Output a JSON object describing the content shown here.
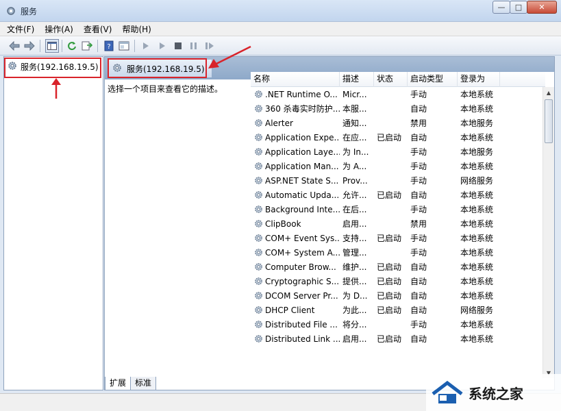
{
  "window": {
    "title": "服务",
    "minimize": "—",
    "maximize": "□",
    "close": "✕"
  },
  "menu": [
    "文件(F)",
    "操作(A)",
    "查看(V)",
    "帮助(H)"
  ],
  "tree": {
    "node_label": "服务(192.168.19.5)"
  },
  "right": {
    "header_label": "服务(192.168.19.5)",
    "description_hint": "选择一个项目来查看它的描述。",
    "columns": [
      "名称",
      "描述",
      "状态",
      "启动类型",
      "登录为"
    ],
    "rows": [
      {
        "name": ".NET Runtime O...",
        "desc": "Micr...",
        "state": "",
        "type": "手动",
        "logon": "本地系统"
      },
      {
        "name": "360 杀毒实时防护...",
        "desc": "本服...",
        "state": "",
        "type": "自动",
        "logon": "本地系统"
      },
      {
        "name": "Alerter",
        "desc": "通知...",
        "state": "",
        "type": "禁用",
        "logon": "本地服务"
      },
      {
        "name": "Application Expe...",
        "desc": "在应...",
        "state": "已启动",
        "type": "自动",
        "logon": "本地系统"
      },
      {
        "name": "Application Laye...",
        "desc": "为 In...",
        "state": "",
        "type": "手动",
        "logon": "本地服务"
      },
      {
        "name": "Application Man...",
        "desc": "为 A...",
        "state": "",
        "type": "手动",
        "logon": "本地系统"
      },
      {
        "name": "ASP.NET State S...",
        "desc": "Prov...",
        "state": "",
        "type": "手动",
        "logon": "网络服务"
      },
      {
        "name": "Automatic Upda...",
        "desc": "允许...",
        "state": "已启动",
        "type": "自动",
        "logon": "本地系统"
      },
      {
        "name": "Background Inte...",
        "desc": "在后...",
        "state": "",
        "type": "手动",
        "logon": "本地系统"
      },
      {
        "name": "ClipBook",
        "desc": "启用...",
        "state": "",
        "type": "禁用",
        "logon": "本地系统"
      },
      {
        "name": "COM+ Event Sys...",
        "desc": "支持...",
        "state": "已启动",
        "type": "手动",
        "logon": "本地系统"
      },
      {
        "name": "COM+ System A...",
        "desc": "管理...",
        "state": "",
        "type": "手动",
        "logon": "本地系统"
      },
      {
        "name": "Computer Brow...",
        "desc": "维护...",
        "state": "已启动",
        "type": "自动",
        "logon": "本地系统"
      },
      {
        "name": "Cryptographic S...",
        "desc": "提供...",
        "state": "已启动",
        "type": "自动",
        "logon": "本地系统"
      },
      {
        "name": "DCOM Server Pr...",
        "desc": "为 D...",
        "state": "已启动",
        "type": "自动",
        "logon": "本地系统"
      },
      {
        "name": "DHCP Client",
        "desc": "为此...",
        "state": "已启动",
        "type": "自动",
        "logon": "网络服务"
      },
      {
        "name": "Distributed File ...",
        "desc": "将分...",
        "state": "",
        "type": "手动",
        "logon": "本地系统"
      },
      {
        "name": "Distributed Link ...",
        "desc": "启用...",
        "state": "已启动",
        "type": "自动",
        "logon": "本地系统"
      }
    ],
    "tabs": [
      "扩展",
      "标准"
    ]
  },
  "watermark": {
    "text": "系统之家"
  },
  "colors": {
    "annotation_red": "#d9232a",
    "header_blue": "#8ea9c9"
  }
}
